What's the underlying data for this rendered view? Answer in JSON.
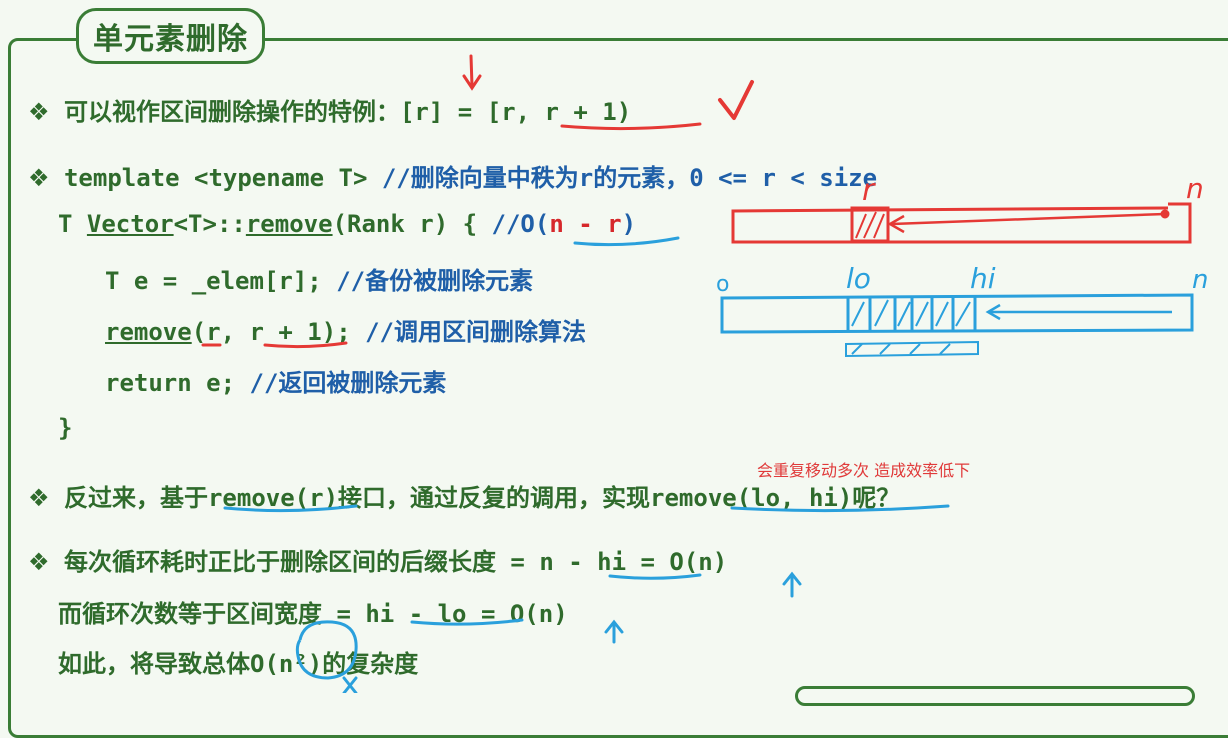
{
  "title": "单元素删除",
  "bullet": "❖",
  "line1": {
    "text": "可以视作区间删除操作的特例：",
    "code_a": "[r]",
    "eq": " = ",
    "code_b": "[r, r + 1)"
  },
  "line2": {
    "code": "template <typename T> ",
    "comment": "//删除向量中秩为r的元素，0 <= r < size"
  },
  "line3": {
    "pre": "T ",
    "cls": "Vector",
    "mid": "<T>::",
    "fn": "remove",
    "post": "(Rank r) { ",
    "comment_pre": "//O(",
    "comment_mid": "n - r",
    "comment_post": ")"
  },
  "line4": {
    "code": "T e = _elem[r]; ",
    "comment": "//备份被删除元素"
  },
  "line5": {
    "fn": "remove",
    "code": "(r, r + 1); ",
    "comment": "//调用区间删除算法"
  },
  "line6": {
    "code": "return e; ",
    "comment": "//返回被删除元素"
  },
  "line7": {
    "code": "}"
  },
  "line8": {
    "zh1": "反过来，基于",
    "code1": "remove(r)",
    "zh2": "接口，通过反复的调用，实现",
    "code2": "remove(lo, hi)",
    "zh3": "呢？"
  },
  "annotation_red": "会重复移动多次 造成效率低下",
  "line9": {
    "zh": "每次循环耗时正比于删除区间的后缀长度",
    "code": " = n - hi = O(n)"
  },
  "line10": {
    "zh": "而循环次数等于区间宽度",
    "code": " = hi - lo = O(n)"
  },
  "line11": {
    "zh1": "如此，将导致总体",
    "code": "O(n²)",
    "zh2": "的复杂度"
  },
  "diagram_labels": {
    "red_r": "r",
    "red_n": "n",
    "blue_0": "o",
    "blue_lo": "lo",
    "blue_hi": "hi",
    "blue_n": "n"
  },
  "colors": {
    "green": "#2f6b2c",
    "blue": "#1f5fa8",
    "red": "#d6282b",
    "pen_blue": "#2aa0dc",
    "pen_red": "#e53935"
  }
}
